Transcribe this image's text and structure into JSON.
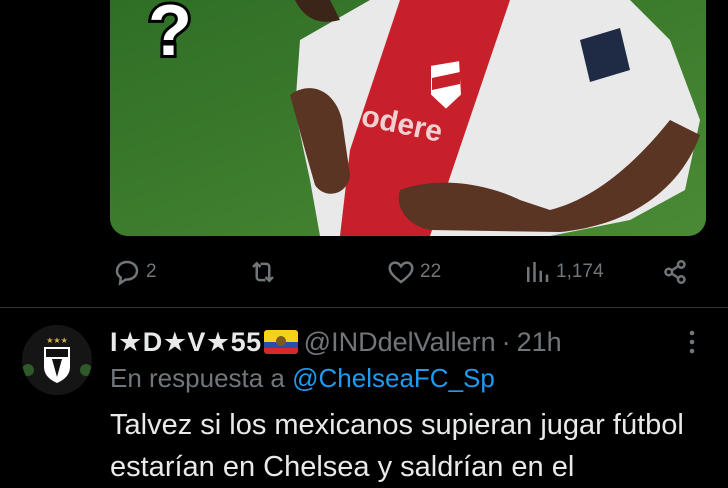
{
  "previous_tweet": {
    "media": {
      "overlay_text": "?",
      "jersey_text": "odere"
    },
    "actions": {
      "replies": "2",
      "retweets": "",
      "likes": "22",
      "views": "1,174"
    }
  },
  "reply_tweet": {
    "display_name": "I★D★V★55",
    "handle": "@INDdelVallern",
    "separator": "·",
    "time": "21h",
    "reply_prefix": "En respuesta a ",
    "reply_mention": "@ChelseaFC_Sp",
    "text": "Talvez si los mexicanos supieran jugar fútbol estarían en Chelsea y saldrían en el"
  },
  "colors": {
    "background": "#000000",
    "text_primary": "#e7e9ea",
    "text_secondary": "#71767b",
    "link": "#1d9bf0",
    "divider": "#2f3336"
  }
}
